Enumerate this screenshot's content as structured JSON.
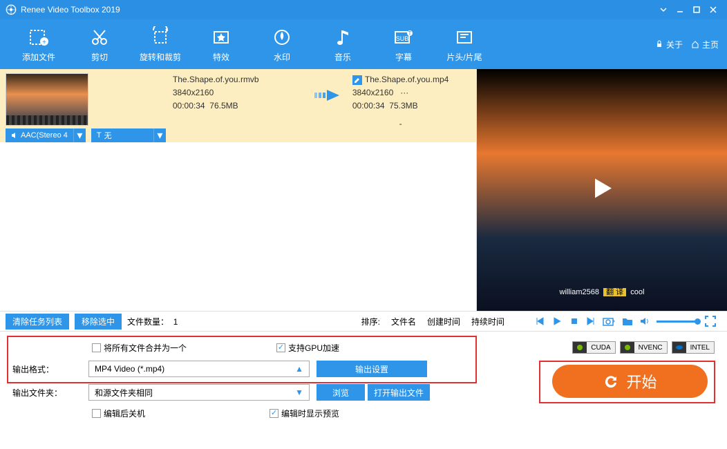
{
  "window": {
    "title": "Renee Video Toolbox 2019"
  },
  "toolbar": {
    "items": [
      {
        "label": "添加文件"
      },
      {
        "label": "剪切"
      },
      {
        "label": "旋转和裁剪"
      },
      {
        "label": "特效"
      },
      {
        "label": "水印"
      },
      {
        "label": "音乐"
      },
      {
        "label": "字幕"
      },
      {
        "label": "片头/片尾"
      }
    ],
    "about": "关于",
    "home": "主页"
  },
  "file": {
    "src": {
      "name": "The.Shape.of.you.rmvb",
      "res": "3840x2160",
      "dur": "00:00:34",
      "size": "76.5MB"
    },
    "dst": {
      "name": "The.Shape.of.you.mp4",
      "res": "3840x2160",
      "extra": "···",
      "dur": "00:00:34",
      "size": "75.3MB",
      "dash": "-"
    },
    "audio_sel": "AAC(Stereo 4",
    "sub_sel": "无"
  },
  "preview": {
    "sub1": "william2568",
    "sub2": "翻 译",
    "sub3": "cool"
  },
  "mid": {
    "clear": "清除任务列表",
    "remove": "移除选中",
    "count_label": "文件数量：",
    "count": "1",
    "sort_label": "排序:",
    "sort_name": "文件名",
    "sort_ctime": "创建时间",
    "sort_dur": "持续时间"
  },
  "settings": {
    "merge": "将所有文件合并为一个",
    "gpu": "支持GPU加速",
    "badges": [
      "CUDA",
      "NVENC",
      "INTEL"
    ],
    "fmt_label": "输出格式：",
    "fmt_value": "MP4 Video (*.mp4)",
    "fmt_btn": "输出设置",
    "folder_label": "输出文件夹：",
    "folder_value": "和源文件夹相同",
    "browse": "浏览",
    "open": "打开输出文件",
    "shutdown": "编辑后关机",
    "preview": "编辑时显示预览",
    "start": "开始"
  }
}
